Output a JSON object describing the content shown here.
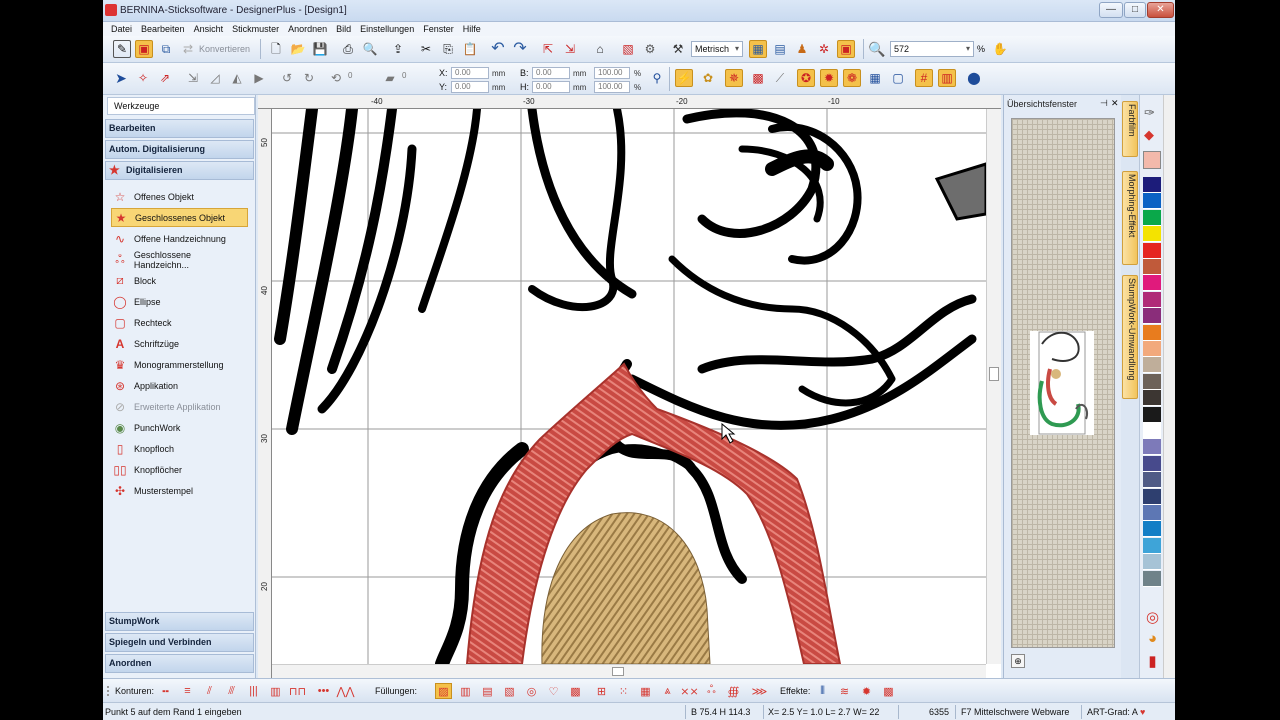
{
  "window": {
    "title": "BERNINA-Sticksoftware - DesignerPlus - [Design1]",
    "buttons": {
      "minimize": "—",
      "maximize": "□",
      "close": "✕"
    }
  },
  "menu": [
    "Datei",
    "Bearbeiten",
    "Ansicht",
    "Stickmuster",
    "Anordnen",
    "Bild",
    "Einstellungen",
    "Fenster",
    "Hilfe"
  ],
  "toolbar1": {
    "convert_label": "Konvertieren",
    "unit_select": "Metrisch",
    "zoom_value": "572",
    "zoom_unit": "%"
  },
  "toolbar2": {
    "x_label": "X:",
    "x_value": "0.00",
    "x_unit": "mm",
    "y_label": "Y:",
    "y_value": "0.00",
    "y_unit": "mm",
    "b_label": "B:",
    "b_value": "0.00",
    "b_unit": "mm",
    "h_label": "H:",
    "h_value": "0.00",
    "h_unit": "mm",
    "bw_value": "100.00",
    "bw_unit": "%",
    "hw_value": "100.00",
    "hw_unit": "%",
    "rotate_value": "0",
    "slant_value": "0"
  },
  "left_panel": {
    "header": "Werkzeuge",
    "categories_top": [
      "Bearbeiten",
      "Autom. Digitalisierung",
      "Digitalisieren"
    ],
    "tools": [
      {
        "label": "Offenes Objekt",
        "icon": "open-star-icon"
      },
      {
        "label": "Geschlossenes Objekt",
        "icon": "filled-star-icon"
      },
      {
        "label": "Offene Handzeichnung",
        "icon": "freehand-line-icon"
      },
      {
        "label": "Geschlossene Handzeichn...",
        "icon": "freehand-closed-icon"
      },
      {
        "label": "Block",
        "icon": "block-icon"
      },
      {
        "label": "Ellipse",
        "icon": "ellipse-icon"
      },
      {
        "label": "Rechteck",
        "icon": "rectangle-icon"
      },
      {
        "label": "Schriftzüge",
        "icon": "lettering-icon"
      },
      {
        "label": "Monogrammerstellung",
        "icon": "monogram-icon"
      },
      {
        "label": "Applikation",
        "icon": "applique-icon"
      },
      {
        "label": "Erweiterte Applikation",
        "icon": "advanced-applique-icon"
      },
      {
        "label": "PunchWork",
        "icon": "punchwork-icon"
      },
      {
        "label": "Knopfloch",
        "icon": "buttonhole-icon"
      },
      {
        "label": "Knopflöcher",
        "icon": "buttonholes-icon"
      },
      {
        "label": "Musterstempel",
        "icon": "pattern-stamp-icon"
      }
    ],
    "categories_bottom": [
      "StumpWork",
      "Spiegeln und Verbinden",
      "Anordnen"
    ]
  },
  "canvas": {
    "ruler_top": [
      "-40",
      "-30",
      "-20",
      "-10"
    ],
    "ruler_left": [
      "50",
      "40",
      "30",
      "20"
    ]
  },
  "overview": {
    "title": "Übersichtsfenster"
  },
  "vertical_tabs": [
    "Farbfilm",
    "Morphing-Effekt",
    "StumpWork-Umwandlung"
  ],
  "palette_colors": [
    "#1c1c7a",
    "#0b62c4",
    "#0aa84a",
    "#f4e300",
    "#e52520",
    "#c05a3a",
    "#e01a7c",
    "#b02a78",
    "#8a2d7a",
    "#e87c1e",
    "#f2a97c",
    "#bfae9a",
    "#6d6259",
    "#3c3632",
    "#1a1a1a",
    "#ffffff",
    "#7d7ab9",
    "#474a8c",
    "#4f5b86",
    "#2e3f6f",
    "#5d77b4",
    "#127ec6",
    "#3ea4d8",
    "#a6c3d6",
    "#6f8289"
  ],
  "bottom_bar": {
    "konturen": "Konturen:",
    "fuellungen": "Füllungen:",
    "effekte": "Effekte:"
  },
  "status": {
    "message": "Punkt 5 auf dem Rand 1 eingeben",
    "size": "B 75.4 H 114.3",
    "coords": "X=   2.5 Y=   1.0 L=   2.7 W=  22",
    "stitches": "6355",
    "fabric": "F7 Mittelschwere Webware",
    "art": "ART-Grad: A"
  }
}
